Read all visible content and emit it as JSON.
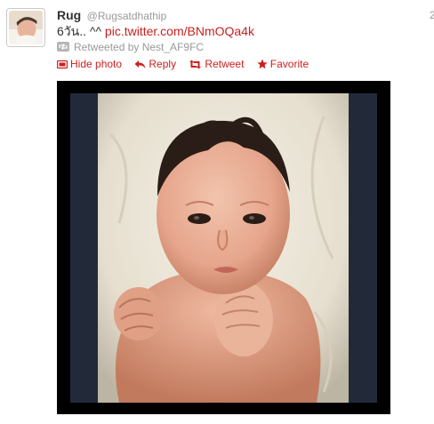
{
  "tweet": {
    "name": "Rug",
    "handle": "@Rugsatdhathip",
    "timestamp": "2",
    "text_prefix": "6วัน.. ^^ ",
    "link": "pic.twitter.com/BNmOQa4k",
    "retweeted_by": "Retweeted by Nest_AF9FC"
  },
  "actions": {
    "hide_photo": "Hide photo",
    "reply": "Reply",
    "retweet": "Retweet",
    "favorite": "Favorite"
  },
  "colors": {
    "accent": "#cc1f1f",
    "muted": "#999999"
  },
  "icons": {
    "hide_photo": "photo-icon",
    "reply": "reply-arrow-icon",
    "retweet": "retweet-arrows-icon",
    "favorite": "star-icon",
    "retweeted": "retweet-badge-icon"
  }
}
